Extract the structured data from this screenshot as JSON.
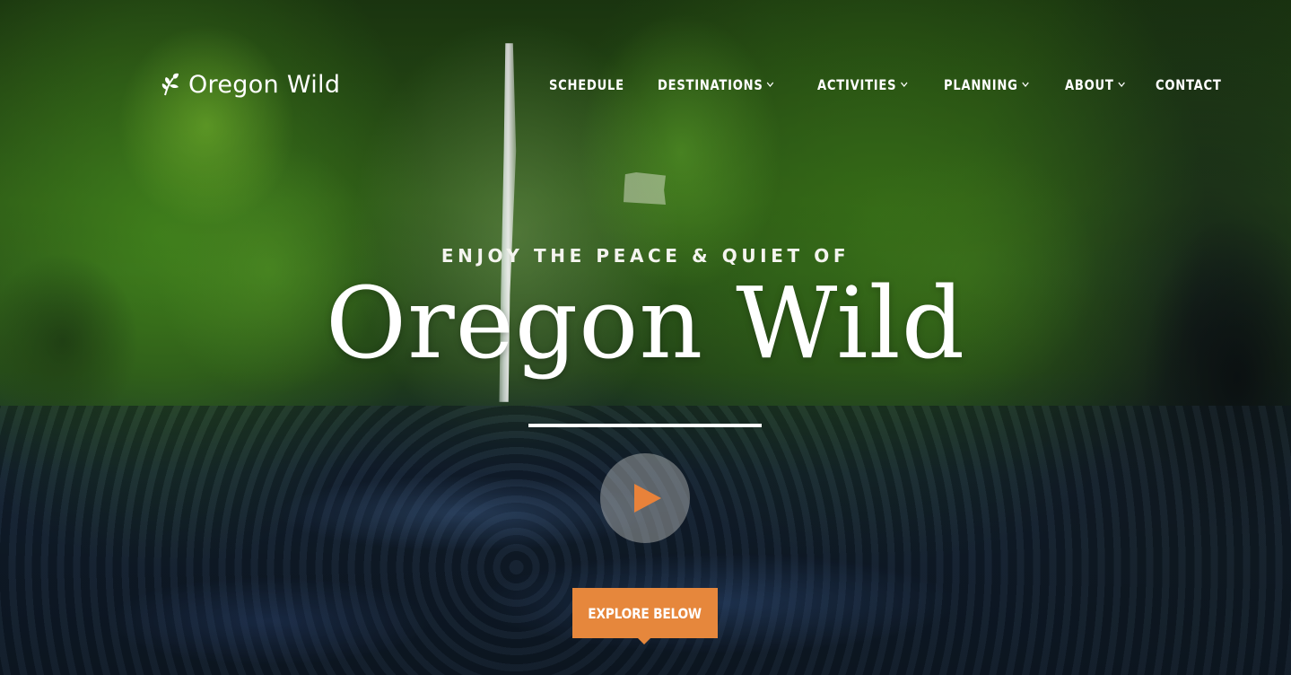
{
  "header": {
    "logo_text": "Oregon Wild",
    "logo_icon": "leaf-sprig-icon"
  },
  "nav": {
    "items": [
      {
        "label": "SCHEDULE",
        "has_dropdown": false
      },
      {
        "label": "DESTINATIONS",
        "has_dropdown": true
      },
      {
        "label": "ACTIVITIES",
        "has_dropdown": true
      },
      {
        "label": "PLANNING",
        "has_dropdown": true
      },
      {
        "label": "ABOUT",
        "has_dropdown": true
      },
      {
        "label": "CONTACT",
        "has_dropdown": false
      }
    ],
    "dropdown_icon": "chevron-down-icon"
  },
  "hero": {
    "emblem_icon": "oregon-state-outline-icon",
    "kicker": "ENJOY THE PEACE & QUIET OF",
    "headline": "Oregon Wild",
    "play_icon": "play-icon",
    "cta_label": "EXPLORE BELOW"
  },
  "colors": {
    "accent": "#e6873c",
    "text": "#ffffff"
  }
}
